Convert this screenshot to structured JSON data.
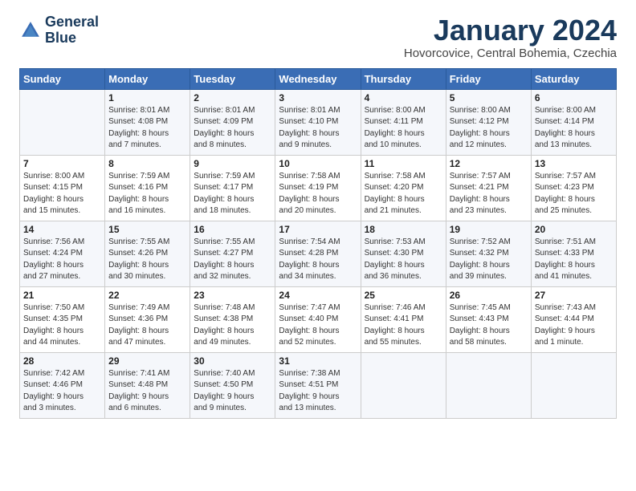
{
  "header": {
    "logo_line1": "General",
    "logo_line2": "Blue",
    "month_title": "January 2024",
    "location": "Hovorcovice, Central Bohemia, Czechia"
  },
  "weekdays": [
    "Sunday",
    "Monday",
    "Tuesday",
    "Wednesday",
    "Thursday",
    "Friday",
    "Saturday"
  ],
  "weeks": [
    [
      {
        "day": "",
        "text": ""
      },
      {
        "day": "1",
        "text": "Sunrise: 8:01 AM\nSunset: 4:08 PM\nDaylight: 8 hours\nand 7 minutes."
      },
      {
        "day": "2",
        "text": "Sunrise: 8:01 AM\nSunset: 4:09 PM\nDaylight: 8 hours\nand 8 minutes."
      },
      {
        "day": "3",
        "text": "Sunrise: 8:01 AM\nSunset: 4:10 PM\nDaylight: 8 hours\nand 9 minutes."
      },
      {
        "day": "4",
        "text": "Sunrise: 8:00 AM\nSunset: 4:11 PM\nDaylight: 8 hours\nand 10 minutes."
      },
      {
        "day": "5",
        "text": "Sunrise: 8:00 AM\nSunset: 4:12 PM\nDaylight: 8 hours\nand 12 minutes."
      },
      {
        "day": "6",
        "text": "Sunrise: 8:00 AM\nSunset: 4:14 PM\nDaylight: 8 hours\nand 13 minutes."
      }
    ],
    [
      {
        "day": "7",
        "text": "Sunrise: 8:00 AM\nSunset: 4:15 PM\nDaylight: 8 hours\nand 15 minutes."
      },
      {
        "day": "8",
        "text": "Sunrise: 7:59 AM\nSunset: 4:16 PM\nDaylight: 8 hours\nand 16 minutes."
      },
      {
        "day": "9",
        "text": "Sunrise: 7:59 AM\nSunset: 4:17 PM\nDaylight: 8 hours\nand 18 minutes."
      },
      {
        "day": "10",
        "text": "Sunrise: 7:58 AM\nSunset: 4:19 PM\nDaylight: 8 hours\nand 20 minutes."
      },
      {
        "day": "11",
        "text": "Sunrise: 7:58 AM\nSunset: 4:20 PM\nDaylight: 8 hours\nand 21 minutes."
      },
      {
        "day": "12",
        "text": "Sunrise: 7:57 AM\nSunset: 4:21 PM\nDaylight: 8 hours\nand 23 minutes."
      },
      {
        "day": "13",
        "text": "Sunrise: 7:57 AM\nSunset: 4:23 PM\nDaylight: 8 hours\nand 25 minutes."
      }
    ],
    [
      {
        "day": "14",
        "text": "Sunrise: 7:56 AM\nSunset: 4:24 PM\nDaylight: 8 hours\nand 27 minutes."
      },
      {
        "day": "15",
        "text": "Sunrise: 7:55 AM\nSunset: 4:26 PM\nDaylight: 8 hours\nand 30 minutes."
      },
      {
        "day": "16",
        "text": "Sunrise: 7:55 AM\nSunset: 4:27 PM\nDaylight: 8 hours\nand 32 minutes."
      },
      {
        "day": "17",
        "text": "Sunrise: 7:54 AM\nSunset: 4:28 PM\nDaylight: 8 hours\nand 34 minutes."
      },
      {
        "day": "18",
        "text": "Sunrise: 7:53 AM\nSunset: 4:30 PM\nDaylight: 8 hours\nand 36 minutes."
      },
      {
        "day": "19",
        "text": "Sunrise: 7:52 AM\nSunset: 4:32 PM\nDaylight: 8 hours\nand 39 minutes."
      },
      {
        "day": "20",
        "text": "Sunrise: 7:51 AM\nSunset: 4:33 PM\nDaylight: 8 hours\nand 41 minutes."
      }
    ],
    [
      {
        "day": "21",
        "text": "Sunrise: 7:50 AM\nSunset: 4:35 PM\nDaylight: 8 hours\nand 44 minutes."
      },
      {
        "day": "22",
        "text": "Sunrise: 7:49 AM\nSunset: 4:36 PM\nDaylight: 8 hours\nand 47 minutes."
      },
      {
        "day": "23",
        "text": "Sunrise: 7:48 AM\nSunset: 4:38 PM\nDaylight: 8 hours\nand 49 minutes."
      },
      {
        "day": "24",
        "text": "Sunrise: 7:47 AM\nSunset: 4:40 PM\nDaylight: 8 hours\nand 52 minutes."
      },
      {
        "day": "25",
        "text": "Sunrise: 7:46 AM\nSunset: 4:41 PM\nDaylight: 8 hours\nand 55 minutes."
      },
      {
        "day": "26",
        "text": "Sunrise: 7:45 AM\nSunset: 4:43 PM\nDaylight: 8 hours\nand 58 minutes."
      },
      {
        "day": "27",
        "text": "Sunrise: 7:43 AM\nSunset: 4:44 PM\nDaylight: 9 hours\nand 1 minute."
      }
    ],
    [
      {
        "day": "28",
        "text": "Sunrise: 7:42 AM\nSunset: 4:46 PM\nDaylight: 9 hours\nand 3 minutes."
      },
      {
        "day": "29",
        "text": "Sunrise: 7:41 AM\nSunset: 4:48 PM\nDaylight: 9 hours\nand 6 minutes."
      },
      {
        "day": "30",
        "text": "Sunrise: 7:40 AM\nSunset: 4:50 PM\nDaylight: 9 hours\nand 9 minutes."
      },
      {
        "day": "31",
        "text": "Sunrise: 7:38 AM\nSunset: 4:51 PM\nDaylight: 9 hours\nand 13 minutes."
      },
      {
        "day": "",
        "text": ""
      },
      {
        "day": "",
        "text": ""
      },
      {
        "day": "",
        "text": ""
      }
    ]
  ]
}
